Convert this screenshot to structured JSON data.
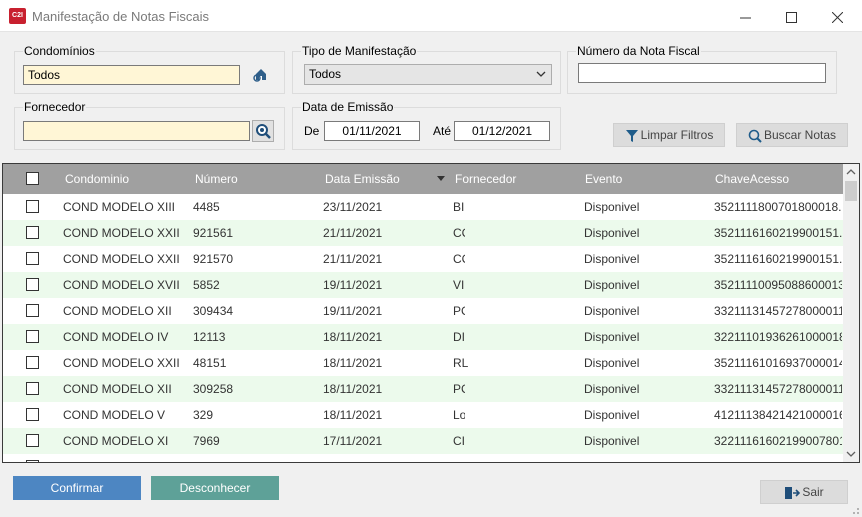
{
  "window": {
    "title": "Manifestação de Notas Fiscais",
    "app_icon_text": "C2I"
  },
  "filters": {
    "condominios": {
      "label": "Condomínios",
      "value": "Todos"
    },
    "tipo_manifestacao": {
      "label": "Tipo de Manifestação",
      "selected": "Todos"
    },
    "numero_nota": {
      "label": "Número da Nota Fiscal",
      "value": ""
    },
    "fornecedor": {
      "label": "Fornecedor",
      "value": ""
    },
    "data_emissao": {
      "label": "Data de Emissão",
      "de_label": "De",
      "de_value": "01/11/2021",
      "ate_label": "Até",
      "ate_value": "01/12/2021"
    },
    "limpar_label": "Limpar Filtros",
    "buscar_label": "Buscar Notas"
  },
  "grid": {
    "columns": [
      "Condominio",
      "Número",
      "Data Emissão",
      "Fornecedor",
      "Evento",
      "ChaveAcesso"
    ],
    "rows": [
      {
        "condominio": "COND MODELO XIII",
        "numero": "4485",
        "data": "23/11/2021",
        "fornecedor": "BI",
        "evento": "Disponivel",
        "chave": "352111180070180001­8..."
      },
      {
        "condominio": "COND MODELO XXII",
        "numero": "921561",
        "data": "21/11/2021",
        "fornecedor": "CC",
        "evento": "Disponivel",
        "chave": "35211161602199001­51..."
      },
      {
        "condominio": "COND MODELO XXII",
        "numero": "921570",
        "data": "21/11/2021",
        "fornecedor": "CC",
        "evento": "Disponivel",
        "chave": "35211161602199001­51..."
      },
      {
        "condominio": "COND MODELO XVII",
        "numero": "5852",
        "data": "19/11/2021",
        "fornecedor": "VI",
        "evento": "Disponivel",
        "chave": "35211110095088600013..."
      },
      {
        "condominio": "COND MODELO XII",
        "numero": "309434",
        "data": "19/11/2021",
        "fornecedor": "PC",
        "evento": "Disponivel",
        "chave": "33211131457278000011..."
      },
      {
        "condominio": "COND MODELO IV",
        "numero": "12113",
        "data": "18/11/2021",
        "fornecedor": "DI",
        "evento": "Disponivel",
        "chave": "32211101936261000018..."
      },
      {
        "condominio": "COND MODELO XXII",
        "numero": "48151",
        "data": "18/11/2021",
        "fornecedor": "RL",
        "evento": "Disponivel",
        "chave": "35211161016937000014..."
      },
      {
        "condominio": "COND MODELO XII",
        "numero": "309258",
        "data": "18/11/2021",
        "fornecedor": "PC",
        "evento": "Disponivel",
        "chave": "33211131457278000011..."
      },
      {
        "condominio": "COND MODELO V",
        "numero": "329",
        "data": "18/11/2021",
        "fornecedor": "Lo",
        "evento": "Disponivel",
        "chave": "41211138421421000016..."
      },
      {
        "condominio": "COND MODELO XI",
        "numero": "7969",
        "data": "17/11/2021",
        "fornecedor": "CI",
        "evento": "Disponivel",
        "chave": "32211161602199007801..."
      }
    ]
  },
  "actions": {
    "confirmar": "Confirmar",
    "desconhecer": "Desconhecer",
    "sair": "Sair"
  },
  "colors": {
    "confirm": "#4d86c2",
    "ignore": "#5ea198",
    "row_alt": "#ecfaec",
    "header": "#a0a0a0",
    "field_highlight": "#fff6d6"
  }
}
